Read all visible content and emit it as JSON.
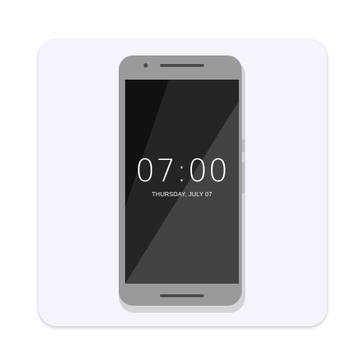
{
  "icon": {
    "name": "phone-clock-app-icon",
    "colors": {
      "tile": "#f7f3fc",
      "phone_body": "#9a9a9a",
      "screen": "#434343",
      "text": "#ffffff"
    }
  },
  "screen": {
    "time": "07:00",
    "date": "THURSDAY, JULY 07"
  }
}
